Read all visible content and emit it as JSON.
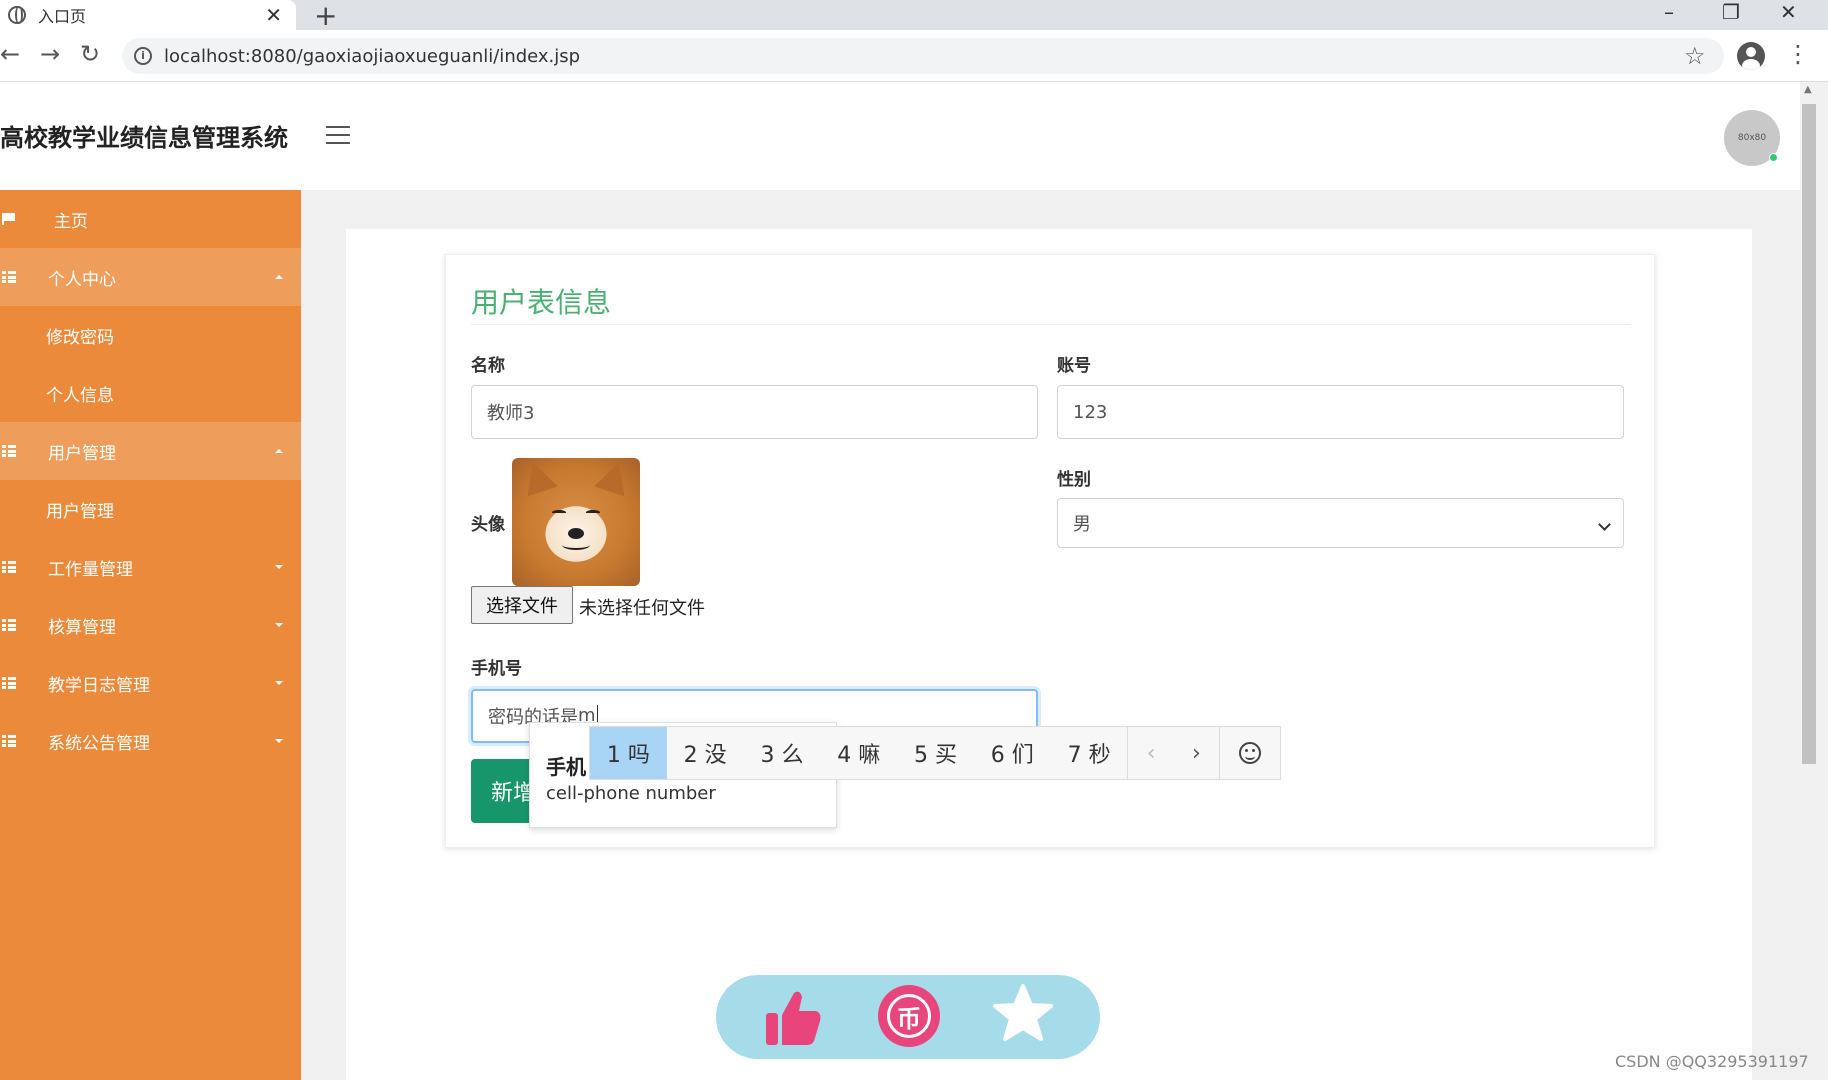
{
  "browser": {
    "tab_title": "入口页",
    "tab_close": "✕",
    "new_tab": "+",
    "url": "localhost:8080/gaoxiaojiaoxueguanli/index.jsp",
    "window_controls": [
      "–",
      "❐",
      "✕"
    ],
    "nav": {
      "back": "←",
      "forward": "→",
      "reload": "↻"
    },
    "bookmark_star": "☆",
    "menu": "⋮"
  },
  "header": {
    "title": "高校教学业绩信息管理系统",
    "avatar_text": "80x80"
  },
  "sidebar": {
    "items": [
      {
        "label": "主页",
        "icon": "flag-icon"
      },
      {
        "label": "个人中心",
        "icon": "grid-icon",
        "expanded": true,
        "children": [
          "修改密码",
          "个人信息"
        ]
      },
      {
        "label": "用户管理",
        "icon": "grid-icon",
        "expanded": true,
        "children": [
          "用户管理"
        ]
      },
      {
        "label": "工作量管理",
        "icon": "grid-icon",
        "expanded": false
      },
      {
        "label": "核算管理",
        "icon": "grid-icon",
        "expanded": false
      },
      {
        "label": "教学日志管理",
        "icon": "grid-icon",
        "expanded": false
      },
      {
        "label": "系统公告管理",
        "icon": "grid-icon",
        "expanded": false
      }
    ]
  },
  "form": {
    "title": "用户表信息",
    "name_label": "名称",
    "name_value": "教师3",
    "account_label": "账号",
    "account_value": "123",
    "avatar_label": "头像",
    "file_button": "选择文件",
    "file_status": "未选择任何文件",
    "gender_label": "性别",
    "gender_value": "男",
    "phone_label": "手机号",
    "phone_value_committed": "密码的话是",
    "phone_value_composing": "m",
    "submit_partial": "新增"
  },
  "ime": {
    "tip_word": "手机",
    "tip_translation": "cell-phone number",
    "candidates": [
      "1 吗",
      "2 没",
      "3 么",
      "4 嘛",
      "5 买",
      "6 们",
      "7 秒"
    ],
    "selected_index": 0,
    "prev": "‹",
    "next": "›"
  },
  "floating_actions": [
    "like-icon",
    "coin-icon",
    "favorite-icon"
  ],
  "coin_glyph": "币",
  "watermark": "CSDN @QQ3295391197"
}
